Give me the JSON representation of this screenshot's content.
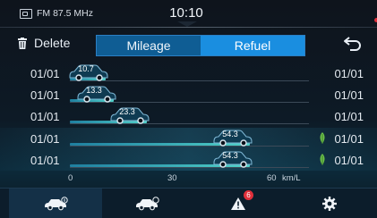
{
  "status": {
    "radio": "FM 87.5 MHz",
    "time": "10:10"
  },
  "toolbar": {
    "delete_label": "Delete",
    "tabs": [
      {
        "label": "Mileage"
      },
      {
        "label": "Refuel"
      }
    ],
    "active_tab": "Refuel"
  },
  "rows": [
    {
      "date_left": "01/01",
      "date_right": "01/01",
      "value": "10.7",
      "economy": 10.7,
      "eco": false
    },
    {
      "date_left": "01/01",
      "date_right": "01/01",
      "value": "13.3",
      "economy": 13.3,
      "eco": false
    },
    {
      "date_left": "01/01",
      "date_right": "01/01",
      "value": "23.3",
      "economy": 23.3,
      "eco": false
    },
    {
      "date_left": "01/01",
      "date_right": "01/01",
      "value": "54.3",
      "economy": 54.3,
      "eco": true
    },
    {
      "date_left": "01/01",
      "date_right": "01/01",
      "value": "54.3",
      "economy": 54.3,
      "eco": true
    }
  ],
  "axis": {
    "ticks": [
      "0",
      "30",
      "60"
    ],
    "unit": "km/L",
    "max": 60
  },
  "nav": {
    "warning_badge": "6"
  },
  "colors": {
    "accent": "#1a8ee0",
    "bar": "#4fd0c8",
    "eco_leaf": "#6cc04a",
    "badge": "#e0303b"
  }
}
